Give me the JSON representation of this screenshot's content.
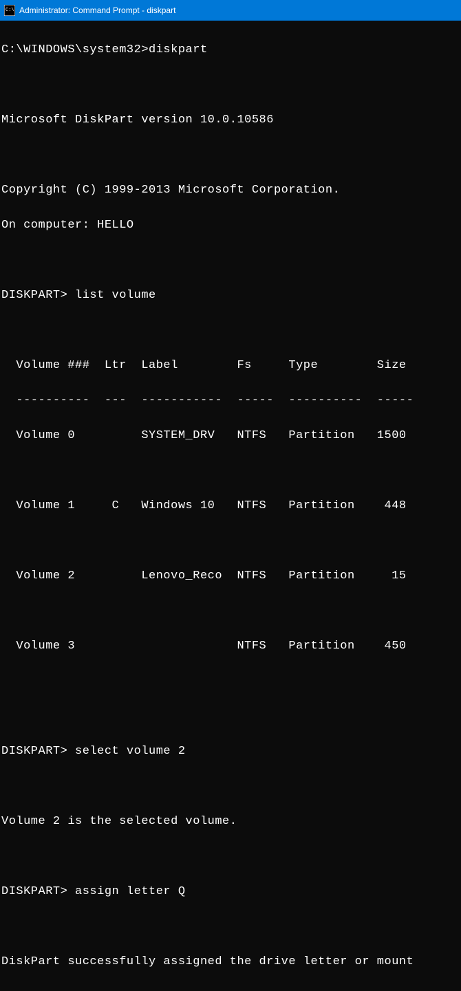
{
  "titlebar": {
    "text": "Administrator: Command Prompt - diskpart"
  },
  "terminal": {
    "prompt_line": "C:\\WINDOWS\\system32>diskpart",
    "blank": "",
    "version_line": "Microsoft DiskPart version 10.0.10586",
    "copyright_line": "Copyright (C) 1999-2013 Microsoft Corporation.",
    "computer_line": "On computer: HELLO",
    "cmd1": "DISKPART> list volume",
    "table_header": "  Volume ###  Ltr  Label        Fs     Type        Size ",
    "table_divider": "  ----------  ---  -----------  -----  ----------  -----",
    "vol0": "  Volume 0         SYSTEM_DRV   NTFS   Partition   1500 ",
    "vol1": "  Volume 1     C   Windows 10   NTFS   Partition    448 ",
    "vol2": "  Volume 2         Lenovo_Reco  NTFS   Partition     15 ",
    "vol3": "  Volume 3                      NTFS   Partition    450 ",
    "cmd2": "DISKPART> select volume 2",
    "result2": "Volume 2 is the selected volume.",
    "cmd3": "DISKPART> assign letter Q",
    "result3": "DiskPart successfully assigned the drive letter or mount"
  }
}
